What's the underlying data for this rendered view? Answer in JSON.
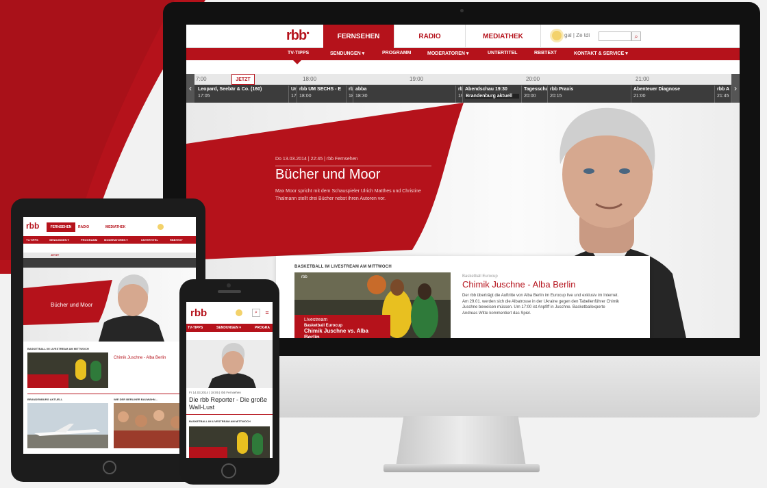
{
  "colors": {
    "brand": "#b5121b",
    "nav_bg": "#b5121b",
    "timeline_bg": "#3c3c3c"
  },
  "desktop": {
    "logo": "rbb",
    "tabs": [
      "FERNSEHEN",
      "RADIO",
      "MEDIATHEK"
    ],
    "active_tab": "FERNSEHEN",
    "weather_icon": "sun-icon",
    "langs": "gal | Ze tdi",
    "subnav": [
      "TV-TIPPS",
      "SENDUNGEN ▾",
      "PROGRAMM",
      "MODERATOREN ▾",
      "UNTERTITEL",
      "RBBTEXT",
      "KONTAKT & SERVICE ▾"
    ],
    "timeline": {
      "now_label": "JETZT",
      "hours": [
        "7:00",
        "18:00",
        "19:00",
        "20:00",
        "21:00"
      ],
      "programs": [
        {
          "title": "Leopard, Seebär & Co. (160)",
          "time": "17:05"
        },
        {
          "title": "Ur",
          "time": "17"
        },
        {
          "title": "rbb UM SECHS - E",
          "time": "18:00"
        },
        {
          "title": "rb",
          "time": "18"
        },
        {
          "title": "abba",
          "time": "18:30"
        },
        {
          "title": "rb",
          "time": "19"
        },
        {
          "title": "Abendschau 19:30",
          "time": "Brandenburg aktuell"
        },
        {
          "title": "Tagesscha",
          "time": "20:00"
        },
        {
          "title": "rbb Praxis",
          "time": "20:15"
        },
        {
          "title": "Abenteuer Diagnose",
          "time": "21:00"
        },
        {
          "title": "rbb A",
          "time": "21:45"
        }
      ]
    },
    "hero": {
      "meta": "Do 13.03.2014 | 22:45 | rbb Fernsehen",
      "title": "Bücher und Moor",
      "desc": "Max Moor spricht mit dem Schauspieler Ulrich Matthes und Christine Thalmann stellt drei Bücher nebst ihren Autoren vor."
    },
    "card": {
      "section_title": "BASKETBALL IM LIVESTREAM AM MITTWOCH",
      "kicker": "Basketball Eurocup",
      "headline": "Chimik Juschne - Alba Berlin",
      "text": "Der rbb überträgt die Auftritte von Alba Berlin im Eurocup live und exklusiv im Internet. Am 29.01. werden sich die Albatrosse in der Ukraine gegen den Tabellenführer Chimik Juschne beweisen müssen. Um 17:00 ist Anpfiff in Juschne. Basketballexperte Andreas Witte kommentiert das Spiel.",
      "live_a": "Livestream",
      "live_b": "Basketball Eurocup",
      "live_c": "Chimik Juschne vs. Alba Berlin",
      "img_label": "rbb"
    }
  },
  "tablet": {
    "logo": "rbb",
    "tabs": [
      "FERNSEHEN",
      "RADIO",
      "MEDIATHEK"
    ],
    "subnav": [
      "TV-TIPPS",
      "SENDUNGEN ▾",
      "PROGRAMM",
      "MODERATOREN ▾",
      "UNTERTITEL",
      "RBBTEXT"
    ],
    "now_label": "JETZT",
    "hero_title": "Bücher und Moor",
    "card_title": "BASKETBALL IM LIVESTREAM AM MITTWOCH",
    "card_head": "Chimik Juschne - Alba Berlin",
    "section_a": "BRANDENBURG AKTUELL",
    "section_b": "WIE DER BERLINER BAUWAHN..."
  },
  "phone": {
    "logo": "rbb",
    "subnav": [
      "TV-TIPPS",
      "SENDUNGEN ▾",
      "PROGRA"
    ],
    "meta": "Fr 14.03.2014 | 18:05 | rbb Fernsehen",
    "title": "Die rbb Reporter - Die große Wall-Lust",
    "card_title": "BASKETBALL IM LIVESTREAM AM MITTWOCH"
  }
}
